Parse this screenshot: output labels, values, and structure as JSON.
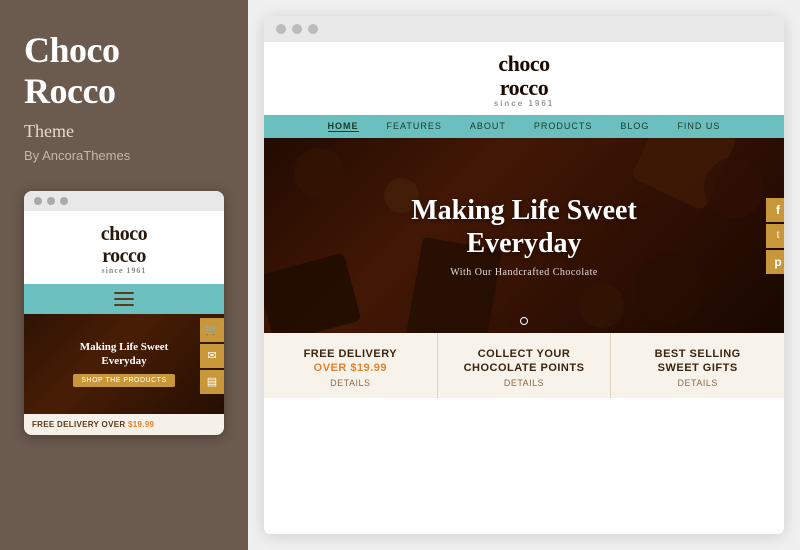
{
  "sidebar": {
    "title_line1": "Choco",
    "title_line2": "Rocco",
    "subtitle": "Theme",
    "by_text": "By AncoraThemes"
  },
  "mobile_preview": {
    "logo_line1": "choco",
    "logo_line2": "rocco",
    "logo_since": "since 1961",
    "hero_title_line1": "Making Life Sweet",
    "hero_title_line2": "Everyday",
    "shop_btn": "SHOP THE PRODUCTS",
    "bottom_text": "FREE DELIVERY OVER ",
    "bottom_price": "$19.99"
  },
  "browser": {
    "site_logo_line1": "choco",
    "site_logo_line2": "rocco",
    "site_logo_since": "since 1961",
    "nav_items": [
      {
        "label": "HOME",
        "active": true
      },
      {
        "label": "FEATURES",
        "active": false
      },
      {
        "label": "ABOUT",
        "active": false
      },
      {
        "label": "PRODUCTS",
        "active": false
      },
      {
        "label": "BLOG",
        "active": false
      },
      {
        "label": "FIND US",
        "active": false
      }
    ],
    "hero_title_line1": "Making Life Sweet",
    "hero_title_line2": "Everyday",
    "hero_subtitle": "With Our Handcrafted Chocolate",
    "features": [
      {
        "title_line1": "FREE DELIVERY",
        "title_line2": "OVER $19.99",
        "details": "Details",
        "has_price": true
      },
      {
        "title_line1": "COLLECT YOUR",
        "title_line2": "CHOCOLATE POINTS",
        "details": "Details",
        "has_price": false
      },
      {
        "title_line1": "BEST SELLING",
        "title_line2": "SWEET GIFTS",
        "details": "Details",
        "has_price": false
      }
    ],
    "side_icons": [
      "f",
      "t",
      "p"
    ]
  }
}
